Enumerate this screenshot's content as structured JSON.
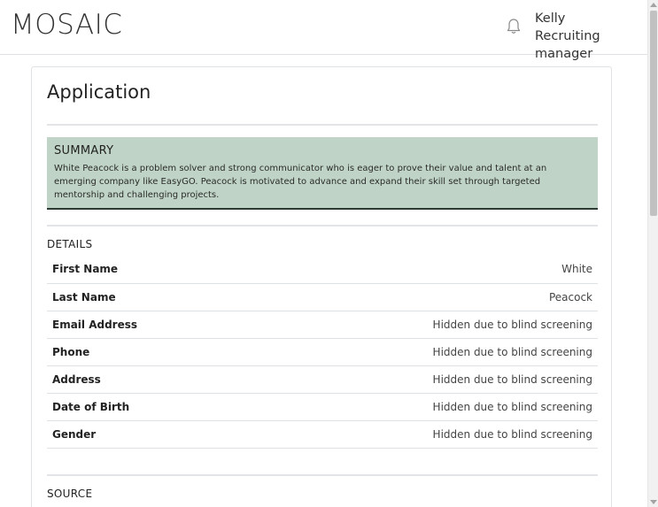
{
  "header": {
    "logo": "MOSAIC",
    "user_name": "Kelly",
    "user_role": "Recruiting manager",
    "notification_icon": "bell-icon"
  },
  "page": {
    "title": "Application"
  },
  "summary": {
    "heading": "SUMMARY",
    "text": "White Peacock is a problem solver and strong communicator who is eager to prove their value and talent at an emerging company like EasyGO. Peacock is motivated to advance and expand their skill set through targeted mentorship and challenging projects."
  },
  "details": {
    "heading": "DETAILS",
    "rows": [
      {
        "label": "First Name",
        "value": "White"
      },
      {
        "label": "Last Name",
        "value": "Peacock"
      },
      {
        "label": "Email Address",
        "value": "Hidden due to blind screening"
      },
      {
        "label": "Phone",
        "value": "Hidden due to blind screening"
      },
      {
        "label": "Address",
        "value": "Hidden due to blind screening"
      },
      {
        "label": "Date of Birth",
        "value": "Hidden due to blind screening"
      },
      {
        "label": "Gender",
        "value": "Hidden due to blind screening"
      }
    ]
  },
  "source": {
    "heading": "SOURCE"
  },
  "colors": {
    "summary_bg": "#bfd4c6",
    "summary_border": "#2c3a34"
  }
}
